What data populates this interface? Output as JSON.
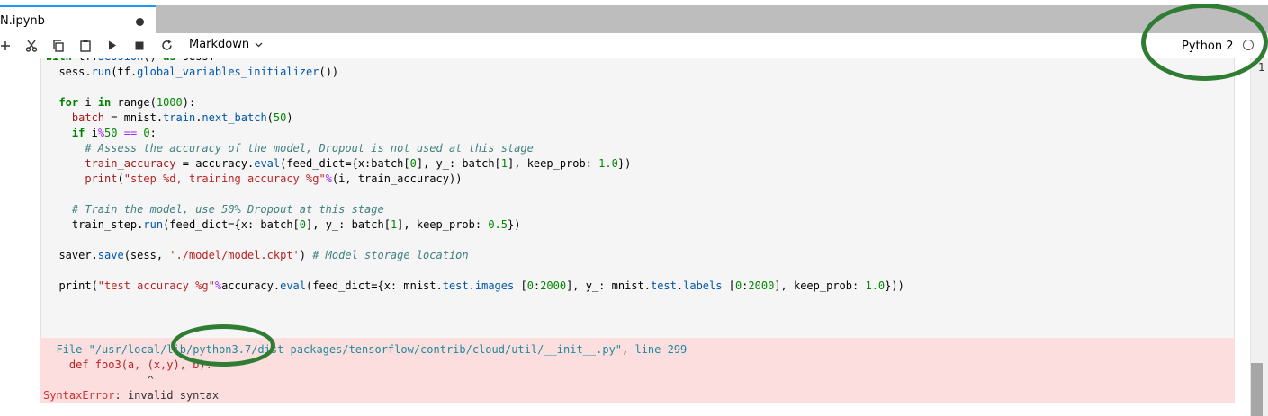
{
  "tab": {
    "title": "N.ipynb"
  },
  "toolbar": {
    "cell_type": "Markdown",
    "buttons": [
      "add-icon",
      "cut-icon",
      "copy-icon",
      "paste-icon",
      "run-icon",
      "stop-icon",
      "restart-icon"
    ],
    "kernel_name": "Python 2"
  },
  "code_lines": [
    "with tf.Session() as sess:",
    "  sess.run(tf.global_variables_initializer())",
    "",
    "  for i in range(1000):",
    "    batch = mnist.train.next_batch(50)",
    "    if i%50 == 0:",
    "      # Assess the accuracy of the model, Dropout is not used at this stage",
    "      train_accuracy = accuracy.eval(feed_dict={x:batch[0], y_: batch[1], keep_prob: 1.0})",
    "      print(\"step %d, training accuracy %g\"%(i, train_accuracy))",
    "",
    "    # Train the model, use 50% Dropout at this stage",
    "    train_step.run(feed_dict={x: batch[0], y_: batch[1], keep_prob: 0.5})",
    "",
    "  saver.save(sess, './model/model.ckpt') # Model storage location",
    "",
    "  print(\"test accuracy %g\"%accuracy.eval(feed_dict={x: mnist.test.images [0:2000], y_: mnist.test.labels [0:2000], keep_prob: 1.0}))"
  ],
  "error": {
    "file_label": "File",
    "path": "\"/usr/local/lib/python3.7/dist-packages/tensorflow/contrib/cloud/util/__init__.py\"",
    "line_label": "line 299",
    "code": "def foo3(a, (x,y), b):",
    "caret": "^",
    "error_name": "SyntaxError",
    "message": "invalid syntax"
  },
  "colors": {
    "annotation": "#2e7d32",
    "error_bg": "#fddede",
    "tab_accent": "#2196f3"
  }
}
